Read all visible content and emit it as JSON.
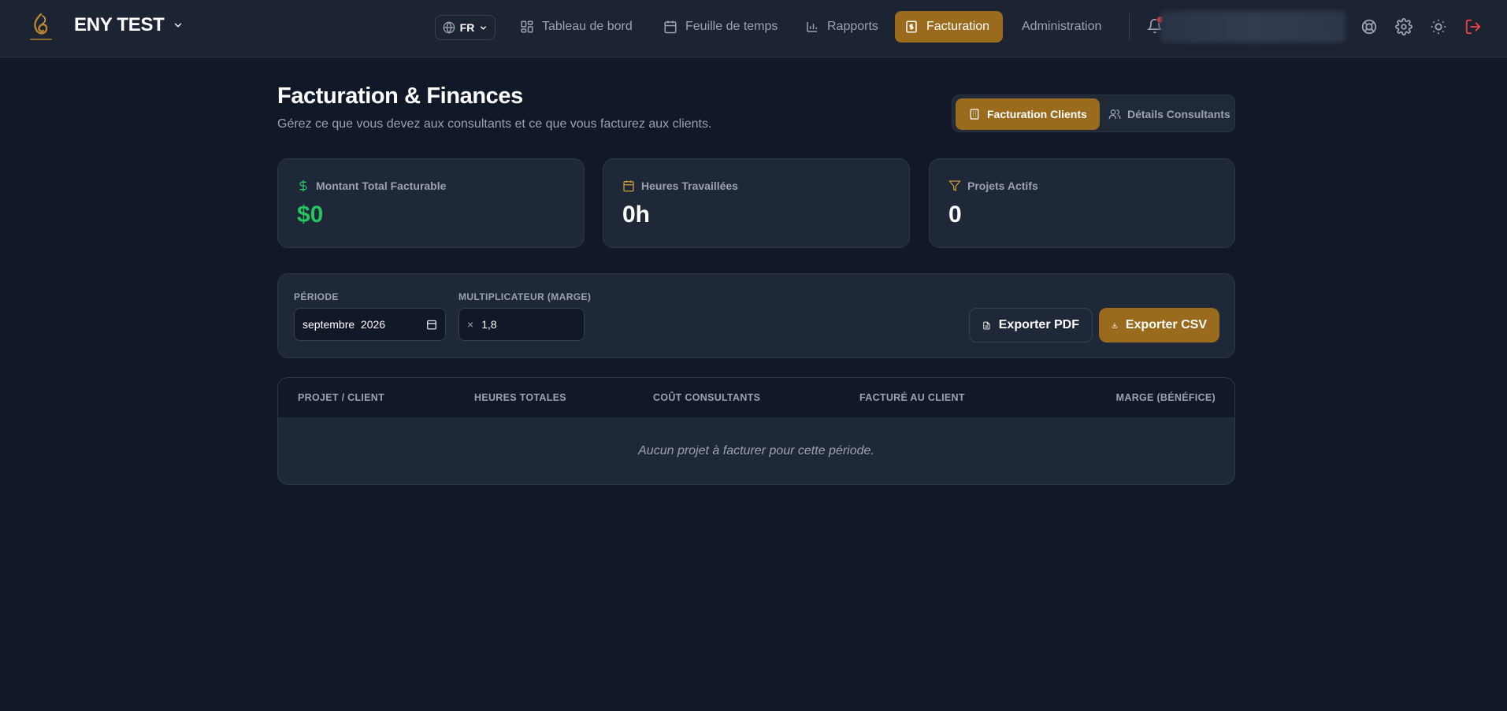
{
  "brand": {
    "name": "ENY TEST",
    "logo_icon": "eny-logo-icon"
  },
  "language": {
    "value": "FR"
  },
  "nav": {
    "items": [
      {
        "label": "Tableau de bord",
        "icon": "dashboard-icon"
      },
      {
        "label": "Feuille de temps",
        "icon": "calendar-icon"
      },
      {
        "label": "Rapports",
        "icon": "bar-chart-icon"
      },
      {
        "label": "Facturation",
        "icon": "invoice-icon",
        "active": true
      },
      {
        "label": "Administration"
      }
    ]
  },
  "topbar_icons": [
    "bell-icon",
    "help-icon",
    "gear-icon",
    "sun-icon",
    "logout-icon"
  ],
  "header": {
    "title": "Facturation & Finances",
    "subtitle": "Gérez ce que vous devez aux consultants et ce que vous facturez aux clients."
  },
  "tabs": {
    "client_billing": "Facturation Clients",
    "consultant_details": "Détails Consultants"
  },
  "stats": {
    "total_billable": {
      "label": "Montant Total Facturable",
      "value": "$0",
      "icon": "dollar-icon"
    },
    "hours_worked": {
      "label": "Heures Travaillées",
      "value": "0h",
      "icon": "calendar-icon"
    },
    "active_projects": {
      "label": "Projets Actifs",
      "value": "0",
      "icon": "filter-icon"
    }
  },
  "filters": {
    "period": {
      "label": "Période",
      "value": "septembre  2026"
    },
    "multiplier": {
      "label": "Multiplicateur (Marge)",
      "prefix": "×",
      "value": "1,8"
    },
    "export_pdf": "Exporter PDF",
    "export_csv": "Exporter CSV"
  },
  "table": {
    "columns": [
      "Projet / Client",
      "Heures totales",
      "Coût consultants",
      "Facturé au client",
      "Marge (Bénéfice)"
    ],
    "empty_message": "Aucun projet à facturer pour cette période."
  },
  "colors": {
    "accent": "#9a6b1c",
    "background": "#111827",
    "surface": "#1e2838",
    "success": "#22c55e",
    "danger": "#ef4444"
  }
}
